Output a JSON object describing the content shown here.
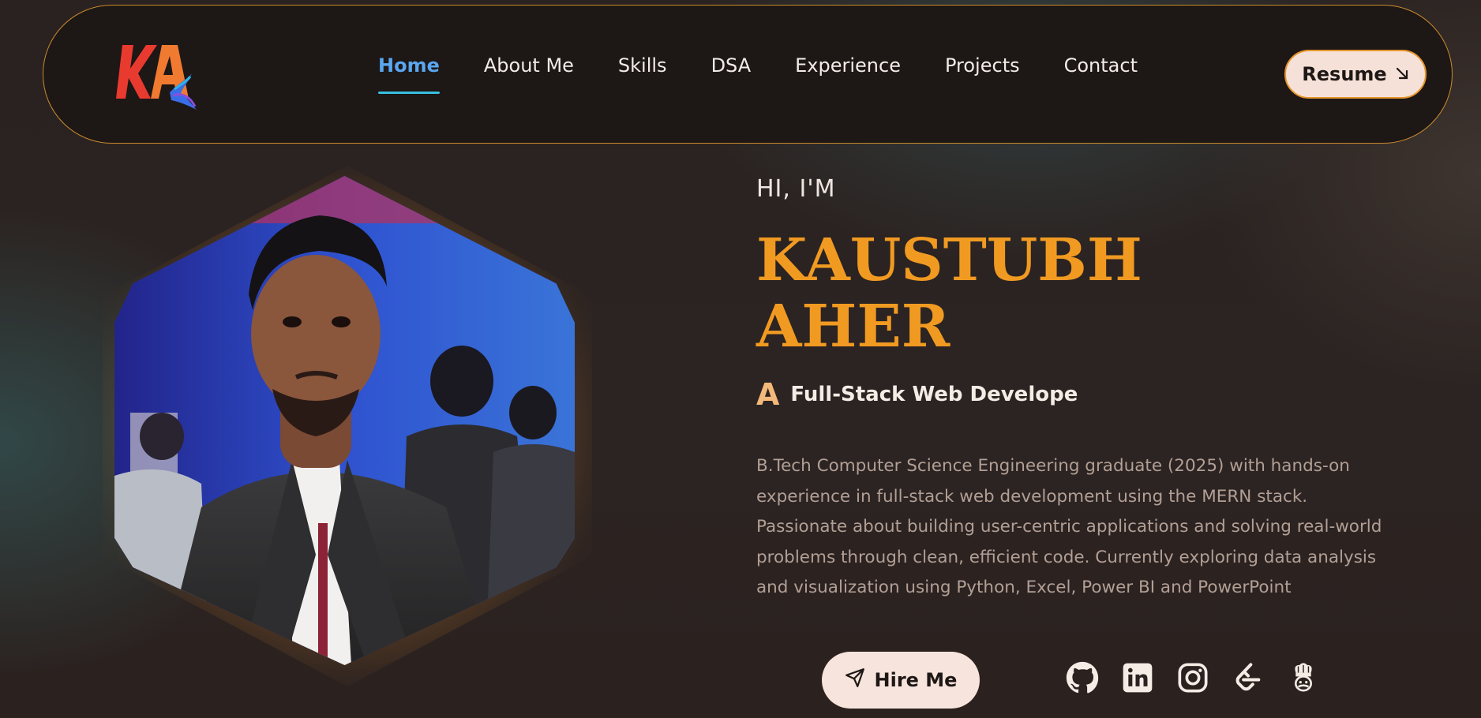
{
  "brand": {
    "logo_text": "KA"
  },
  "nav": {
    "items": [
      {
        "label": "Home",
        "active": true
      },
      {
        "label": "About Me",
        "active": false
      },
      {
        "label": "Skills",
        "active": false
      },
      {
        "label": "DSA",
        "active": false
      },
      {
        "label": "Experience",
        "active": false
      },
      {
        "label": "Projects",
        "active": false
      },
      {
        "label": "Contact",
        "active": false
      }
    ],
    "resume_label": "Resume",
    "resume_icon": "arrow-down-right-icon"
  },
  "hero": {
    "greeting": "HI, I'M",
    "first_name": "KAUSTUBH",
    "last_name": "AHER",
    "role_prefix": "A",
    "role": "Full-Stack Web Develope",
    "bio": "B.Tech Computer Science Engineering graduate (2025) with hands-on experience in full-stack web development using the MERN stack. Passionate about building user-centric applications and solving real-world problems through clean, efficient code. Currently exploring data analysis and visualization using Python, Excel, Power BI and PowerPoint",
    "hire_label": "Hire Me",
    "hire_icon": "send-icon"
  },
  "socials": [
    {
      "name": "github-icon"
    },
    {
      "name": "linkedin-icon"
    },
    {
      "name": "instagram-icon"
    },
    {
      "name": "leetcode-icon"
    },
    {
      "name": "codechef-icon"
    }
  ],
  "colors": {
    "accent": "#f19a22",
    "nav_active": "#5aa6f0",
    "border": "#c98a2e",
    "button_bg": "#f7e4dc",
    "bg": "#2a2220"
  }
}
